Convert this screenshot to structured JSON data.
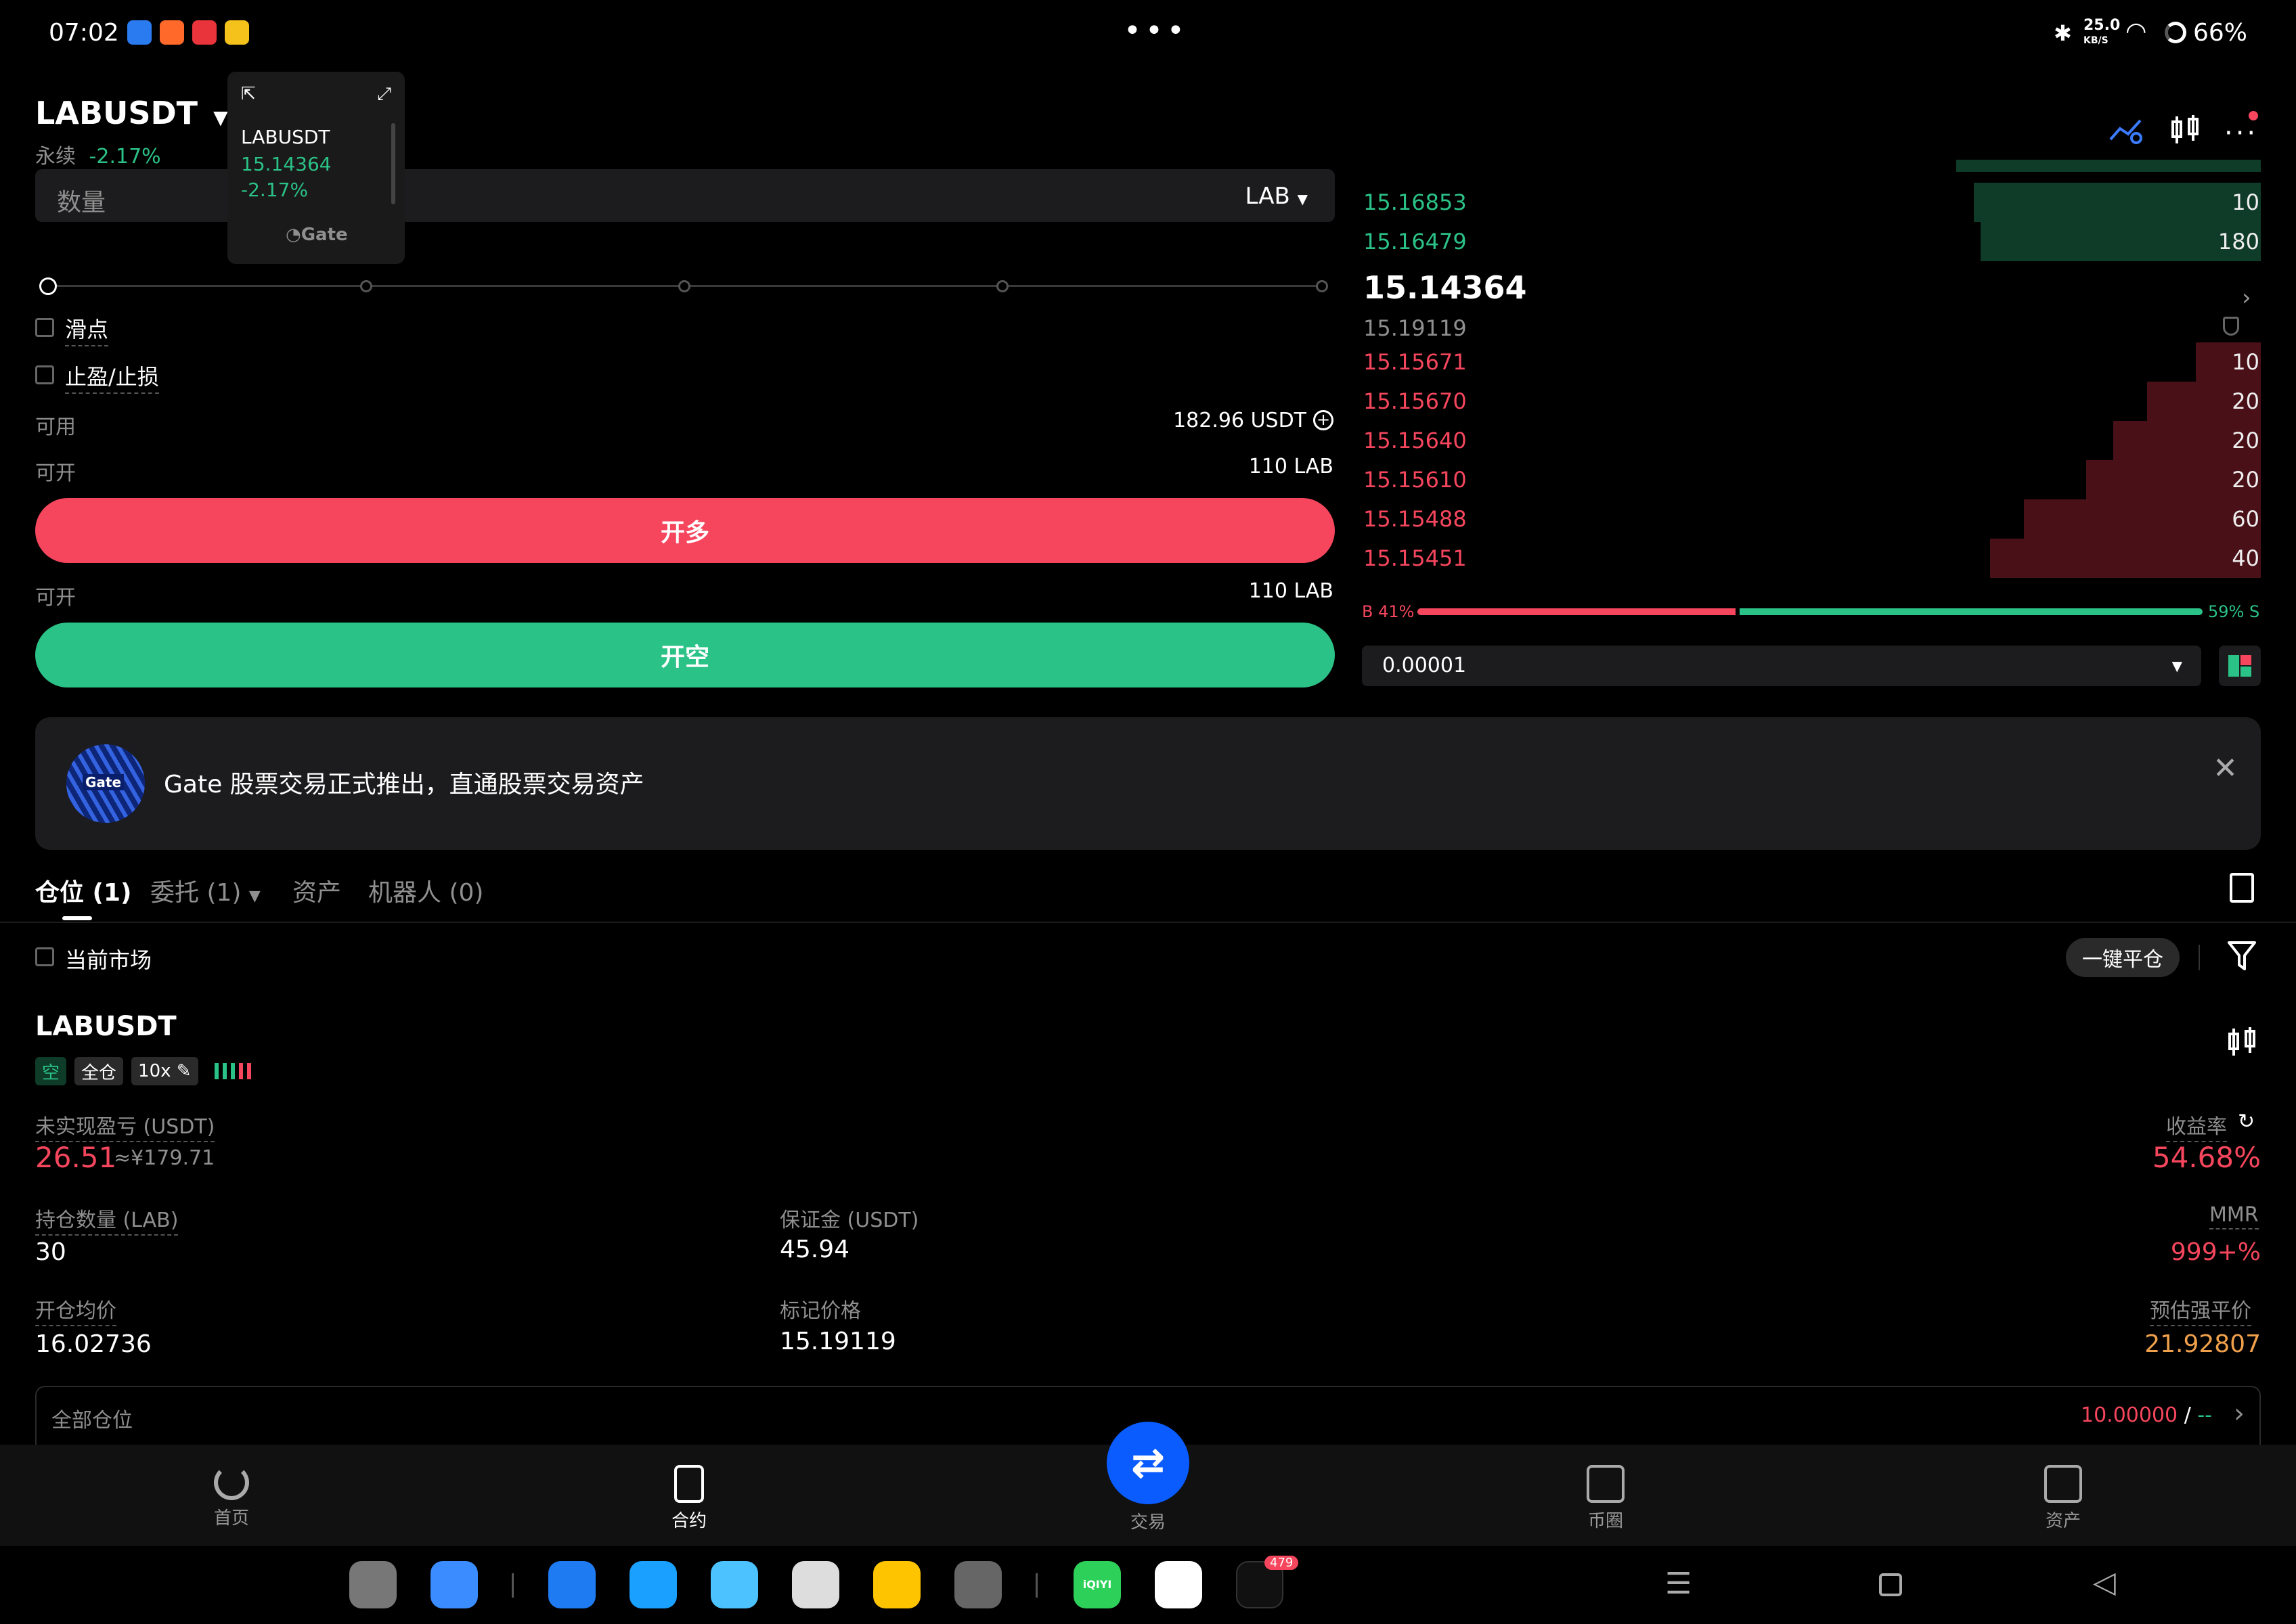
{
  "status_bar": {
    "time": "07:02",
    "net_speed": "25.0",
    "net_unit": "KB/S",
    "battery": "66%"
  },
  "header": {
    "pair": "LABUSDT",
    "contract_type": "永续",
    "change": "-2.17%"
  },
  "mini_window": {
    "pair": "LABUSDT",
    "price": "15.14364",
    "change": "-2.17%",
    "brand": "Gate"
  },
  "order_form": {
    "qty_placeholder": "数量",
    "qty_unit": "LAB",
    "slippage_label": "滑点",
    "tpsl_label": "止盈/止损",
    "available_label": "可用",
    "available_value": "182.96 USDT",
    "can_open_label": "可开",
    "can_open_long": "110 LAB",
    "can_open_short": "110 LAB",
    "long_button": "开多",
    "short_button": "开空"
  },
  "orderbook": {
    "asks_top": [
      {
        "price": "15.16853",
        "qty": "10"
      },
      {
        "price": "15.16479",
        "qty": "180"
      }
    ],
    "last_price": "15.14364",
    "mark_price": "15.19119",
    "bids": [
      {
        "price": "15.15671",
        "qty": "10"
      },
      {
        "price": "15.15670",
        "qty": "20"
      },
      {
        "price": "15.15640",
        "qty": "20"
      },
      {
        "price": "15.15610",
        "qty": "20"
      },
      {
        "price": "15.15488",
        "qty": "60"
      },
      {
        "price": "15.15451",
        "qty": "40"
      }
    ],
    "buy_ratio_label": "B 41%",
    "sell_ratio_label": "59% S",
    "buy_ratio": 0.41,
    "precision": "0.00001"
  },
  "banner": {
    "text": "Gate 股票交易正式推出，直通股票交易资产",
    "logo_text": "Gate"
  },
  "tabs": [
    {
      "label": "仓位 (1)"
    },
    {
      "label": "委托 (1)"
    },
    {
      "label": "资产"
    },
    {
      "label": "机器人 (0)"
    }
  ],
  "position_toolbar": {
    "current_market": "当前市场",
    "close_all": "一键平仓"
  },
  "position": {
    "pair": "LABUSDT",
    "side_tag": "空",
    "margin_mode": "全仓",
    "leverage": "10x",
    "unrealized_label": "未实现盈亏 (USDT)",
    "unrealized_value": "26.51",
    "unrealized_cny": "≈¥179.71",
    "roe_label": "收益率",
    "roe_value": "54.68%",
    "size_label": "持仓数量 (LAB)",
    "size_value": "30",
    "margin_label": "保证金 (USDT)",
    "margin_value": "45.94",
    "mmr_label": "MMR",
    "mmr_value": "999+%",
    "entry_label": "开仓均价",
    "entry_value": "16.02736",
    "mark_label": "标记价格",
    "mark_value": "15.19119",
    "liq_label": "预估强平价",
    "liq_value": "21.92807"
  },
  "all_positions": {
    "label": "全部仓位",
    "value": "10.00000",
    "sep": " / ",
    "value2": "--"
  },
  "bottom_nav": [
    {
      "label": "首页"
    },
    {
      "label": "合约"
    },
    {
      "label": "交易"
    },
    {
      "label": "币圈"
    },
    {
      "label": "资产"
    }
  ],
  "dock": {
    "tiktok_badge": "479",
    "iqiyi_text": "iQIYI"
  },
  "colors": {
    "green": "#2bc287",
    "red": "#f6465d",
    "accent_blue": "#0a5cff"
  }
}
